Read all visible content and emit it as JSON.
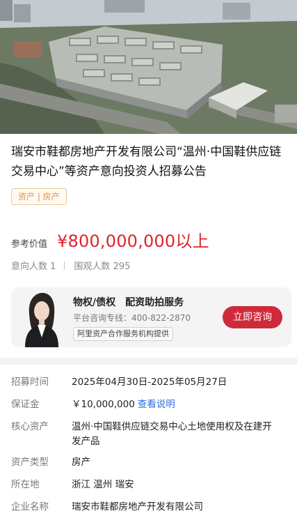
{
  "listing": {
    "title": "瑞安市鞋都房地产开发有限公司“温州·中国鞋供应链交易中心”等资产意向投资人招募公告",
    "tag": "资产 | 房产"
  },
  "price": {
    "label": "参考价值",
    "value": "¥800,000,000以上"
  },
  "stats": {
    "intent": "意向人数 1",
    "views": "围观人数 295"
  },
  "service": {
    "title": "物权/债权　配资助拍服务",
    "phone": "平台咨询专线：400-822-2870",
    "note": "阿里资产合作服务机构提供",
    "button": "立即咨询"
  },
  "details": [
    {
      "label": "招募时间",
      "value": "2025年04月30日-2025年05月27日"
    },
    {
      "label": "保证金",
      "value": "￥10,000,000",
      "link": "查看说明"
    },
    {
      "label": "核心资产",
      "value": "温州·中国鞋供应链交易中心土地使用权及在建开发产品"
    },
    {
      "label": "资产类型",
      "value": "房产"
    },
    {
      "label": "所在地",
      "value": "浙江 温州 瑞安"
    },
    {
      "label": "企业名称",
      "value": "瑞安市鞋都房地产开发有限公司"
    }
  ],
  "colors": {
    "price_red": "#e0232a",
    "button_red": "#cf2a3b",
    "tag_orange": "#e3943d",
    "link_blue": "#2f6fe0"
  },
  "icons": {
    "hero": "aerial-photo-image",
    "avatar": "agent-avatar-image"
  }
}
